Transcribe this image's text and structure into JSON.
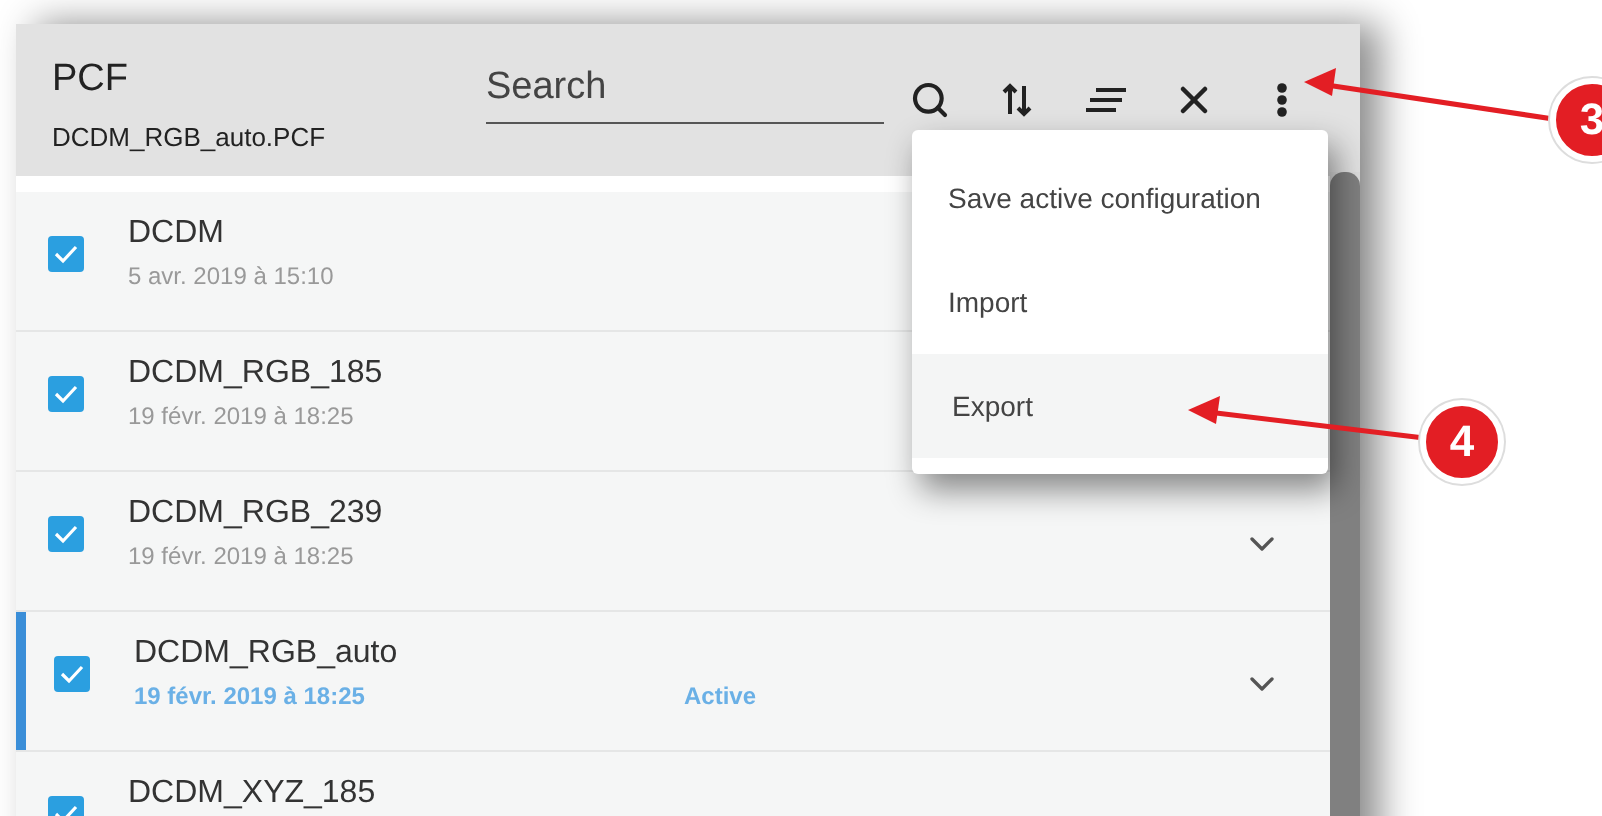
{
  "header": {
    "title": "PCF",
    "subtitle": "DCDM_RGB_auto.PCF",
    "search": {
      "placeholder": "Search"
    }
  },
  "rows": [
    {
      "name": "DCDM",
      "date": "5 avr. 2019 à 15:10",
      "checked": true,
      "active": false
    },
    {
      "name": "DCDM_RGB_185",
      "date": "19 févr. 2019 à 18:25",
      "checked": true,
      "active": false
    },
    {
      "name": "DCDM_RGB_239",
      "date": "19 févr. 2019 à 18:25",
      "checked": true,
      "active": false
    },
    {
      "name": "DCDM_RGB_auto",
      "date": "19 févr. 2019 à 18:25",
      "status": "Active",
      "checked": true,
      "active": true
    },
    {
      "name": "DCDM_XYZ_185",
      "checked": true,
      "active": false
    }
  ],
  "menu": {
    "items": [
      {
        "label": "Save active configuration",
        "selected": false
      },
      {
        "label": "Import",
        "selected": false
      },
      {
        "label": "Export",
        "selected": true
      }
    ]
  },
  "callouts": [
    {
      "number": "3"
    },
    {
      "number": "4"
    }
  ]
}
